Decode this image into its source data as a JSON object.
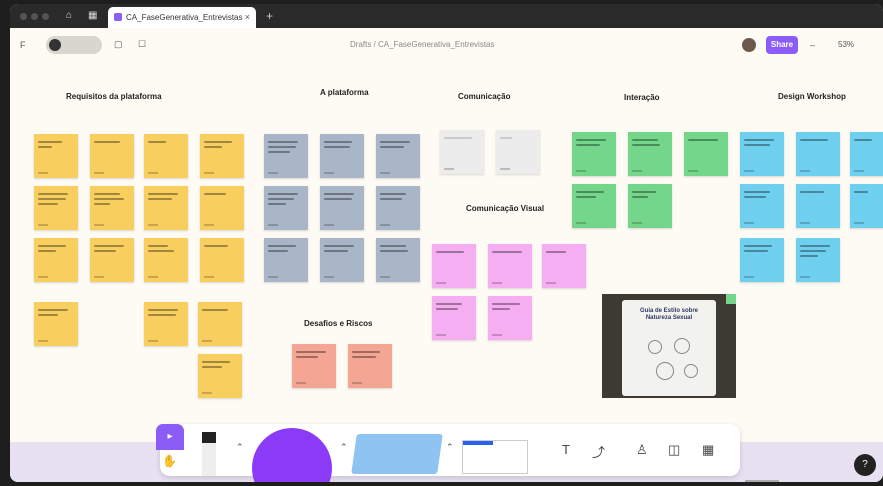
{
  "browser": {
    "tab_title": "CA_FaseGenerativa_Entrevistas",
    "tab_close": "×",
    "new_tab": "+"
  },
  "toolbar": {
    "menu": "F",
    "doc_title": "Drafts / CA_FaseGenerativa_Entrevistas",
    "share_label": "Share",
    "zoom_label": "53%"
  },
  "board": {
    "sections": [
      "Requisitos da plataforma",
      "A plataforma",
      "Comunicação",
      "Interação",
      "Design Workshop",
      "Comunicação Visual",
      "Desafios e Riscos"
    ],
    "photo_title": "Guia de Estilo sobre Natureza Sexual"
  },
  "dock": {
    "select_icon": "cursor-icon",
    "hand_icon": "hand-icon",
    "text_tool": "T",
    "connector_tool": "⤴",
    "help_label": "?"
  },
  "colors": {
    "accent": "#8b5cf6",
    "yellow": "#f8cf5e",
    "gray_blue": "#a9b6c8",
    "pink": "#f6aef2",
    "green": "#74d68b",
    "cyan": "#6fcfee",
    "salmon": "#f5a594"
  }
}
